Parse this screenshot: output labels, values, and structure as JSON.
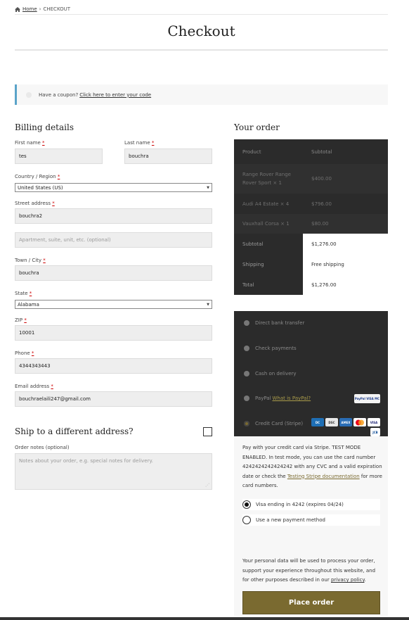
{
  "breadcrumb": {
    "home": "Home",
    "separator": "›",
    "current": "CHECKOUT",
    "home_icon": "home-icon"
  },
  "page_title": "Checkout",
  "coupon": {
    "text": "Have a coupon?",
    "link": "Click here to enter your code"
  },
  "billing": {
    "title": "Billing details",
    "first_name": {
      "label": "First name",
      "req": "*",
      "value": "tes"
    },
    "last_name": {
      "label": "Last name",
      "req": "*",
      "value": "bouchra"
    },
    "country": {
      "label": "Country / Region",
      "req": "*",
      "value": "United States (US)"
    },
    "street": {
      "label": "Street address",
      "req": "*",
      "value": "bouchra2",
      "placeholder2": "Apartment, suite, unit, etc. (optional)"
    },
    "city": {
      "label": "Town / City",
      "req": "*",
      "value": "bouchra"
    },
    "state": {
      "label": "State",
      "req": "*",
      "value": "Alabama"
    },
    "zip": {
      "label": "ZIP",
      "req": "*",
      "value": "10001"
    },
    "phone": {
      "label": "Phone",
      "req": "*",
      "value": "4344343443"
    },
    "email": {
      "label": "Email address",
      "req": "*",
      "value": "bouchraelaili247@gmail.com"
    }
  },
  "shipping": {
    "title": "Ship to a different address?"
  },
  "notes": {
    "label": "Order notes (optional)",
    "placeholder": "Notes about your order, e.g. special notes for delivery."
  },
  "order": {
    "title": "Your order",
    "head": {
      "product": "Product",
      "subtotal": "Subtotal"
    },
    "items": [
      {
        "name": "Range Rover Range Rover Sport × 1",
        "price": "$400.00"
      },
      {
        "name": "Audi A4 Estate × 4",
        "price": "$796.00"
      },
      {
        "name": "Vauxhall Corsa × 1",
        "price": "$80.00"
      }
    ],
    "totals": [
      {
        "label": "Subtotal",
        "value": "$1,276.00"
      },
      {
        "label": "Shipping",
        "value": "Free shipping"
      },
      {
        "label": "Total",
        "value": "$1,276.00"
      }
    ]
  },
  "payment": {
    "bank": "Direct bank transfer",
    "check": "Check payments",
    "cod": "Cash on delivery",
    "paypal": "PayPal",
    "paypal_link": "What is PayPal?",
    "credit": "Credit Card (Stripe)",
    "stripe_desc_1": "Pay with your credit card via Stripe. TEST MODE ENABLED. In test mode, you can use the card number 4242424242424242 with any CVC and a valid expiration date or check the",
    "stripe_link": "Testing Stripe documentation",
    "stripe_desc_2": "for more card numbers.",
    "saved_card": "Visa ending in 4242 (expires 04/24)",
    "new_method": "Use a new payment method",
    "privacy_text": "Your personal data will be used to process your order, support your experience throughout this website, and for other purposes described in our",
    "privacy_link": "privacy policy",
    "privacy_end": ".",
    "place_order": "Place order"
  },
  "colors": {
    "accent": "#7a6a30",
    "dark_panel": "#2b2b2b",
    "coupon_border": "#5aa3c9"
  }
}
